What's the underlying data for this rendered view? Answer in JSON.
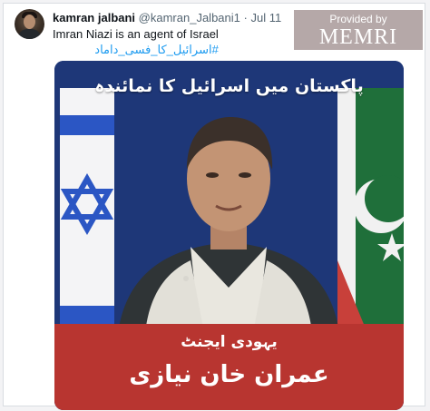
{
  "tweet": {
    "display_name": "kamran jalbani",
    "handle": "@kamran_Jalbani1",
    "separator": "·",
    "date": "Jul 11",
    "text": "Imran Niazi is an agent of Israel",
    "hashtag": "#اسرائیل_کا_فسی_داماد",
    "more_label": "···"
  },
  "badge": {
    "provided_by": "Provided by",
    "brand": "MEMRI"
  },
  "media": {
    "top_caption": "پاکستان میں اسرائیل کا نمائندہ",
    "bottom_line1": "یہودی ایجنٹ",
    "bottom_line2": "عمران خان نیازی",
    "colors": {
      "backdrop": "#1e3778",
      "banner": "#b83530",
      "israel_blue": "#2b56c4",
      "pakistan_green": "#1f6f3a"
    }
  }
}
